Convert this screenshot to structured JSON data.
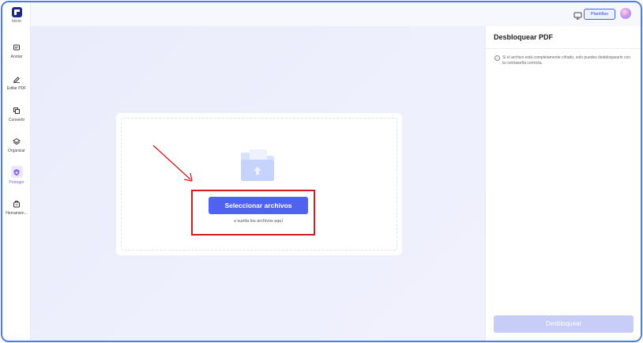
{
  "sidebar": {
    "logo_label": "Inicio",
    "items": [
      {
        "label": "Anotar",
        "icon": "annotate-icon"
      },
      {
        "label": "Editar PDF",
        "icon": "edit-pdf-icon"
      },
      {
        "label": "Convertir",
        "icon": "convert-icon"
      },
      {
        "label": "Organizar",
        "icon": "organize-icon"
      },
      {
        "label": "Proteger",
        "icon": "protect-icon"
      },
      {
        "label": "Herramien...",
        "icon": "tools-icon"
      }
    ],
    "active": "Proteger"
  },
  "topbar": {
    "templates_label": "Plantillas",
    "monitor_icon": "monitor-icon",
    "avatar_icon": "avatar"
  },
  "dropzone": {
    "select_button": "Seleccionar archivos",
    "hint": "o suelta los archivos aquí"
  },
  "panel": {
    "title": "Desbloquear PDF",
    "info_text": "Si el archivo está completamente cifrado, solo puedes desbloquearlo con la contraseña correcta.",
    "unlock_button": "Desbloquear"
  },
  "colors": {
    "accent": "#4f63f0",
    "active_nav": "#7b5cf0",
    "disabled_button": "#c7cdf7",
    "annotation_red": "#d01c1c",
    "frame_border": "#4a7cf0"
  }
}
